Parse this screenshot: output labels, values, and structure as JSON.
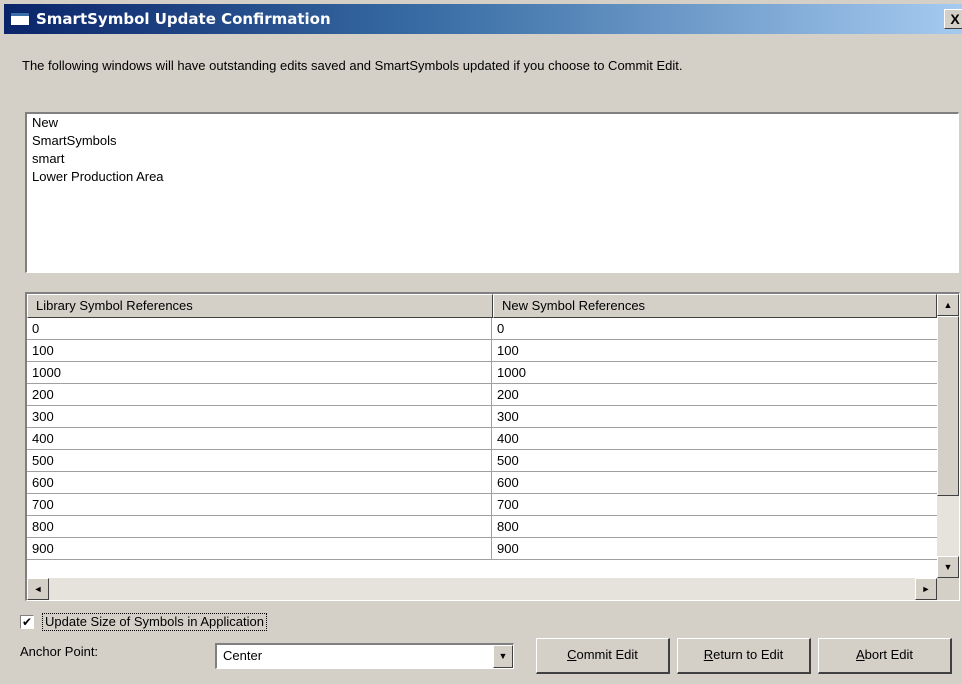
{
  "window": {
    "title": "SmartSymbol Update Confirmation",
    "close_glyph": "X"
  },
  "message": "The following windows will have outstanding edits saved and SmartSymbols updated if you choose to Commit Edit.",
  "windows_list": [
    "New",
    "SmartSymbols",
    "smart",
    "Lower Production Area"
  ],
  "table": {
    "columns": [
      "Library Symbol References",
      "New Symbol References"
    ],
    "rows": [
      [
        "0",
        "0"
      ],
      [
        "100",
        "100"
      ],
      [
        "1000",
        "1000"
      ],
      [
        "200",
        "200"
      ],
      [
        "300",
        "300"
      ],
      [
        "400",
        "400"
      ],
      [
        "500",
        "500"
      ],
      [
        "600",
        "600"
      ],
      [
        "700",
        "700"
      ],
      [
        "800",
        "800"
      ],
      [
        "900",
        "900"
      ]
    ],
    "vscroll_position": 0.75
  },
  "options": {
    "update_size_label": "Update Size of Symbols in Application",
    "update_size_checked": true,
    "anchor_label": "Anchor Point:",
    "anchor_value": "Center"
  },
  "buttons": {
    "commit": {
      "mnemonic": "C",
      "rest": "ommit Edit"
    },
    "return": {
      "mnemonic": "R",
      "rest": "eturn to Edit"
    },
    "abort": {
      "mnemonic": "A",
      "rest": "bort Edit"
    }
  }
}
